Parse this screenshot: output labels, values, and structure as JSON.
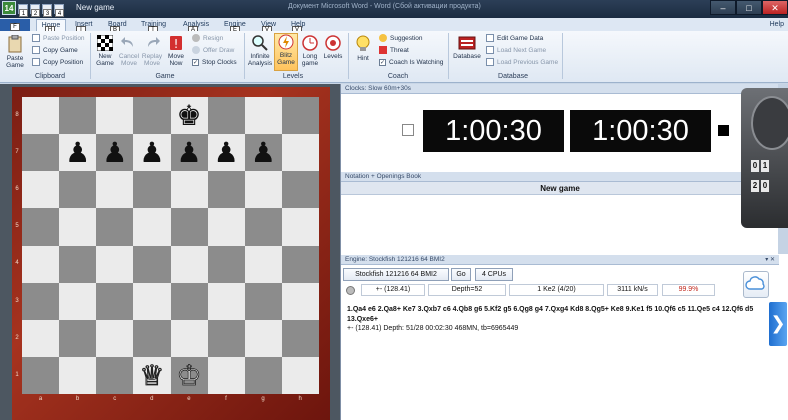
{
  "window": {
    "title": "New game",
    "title_right": "Документ Microsoft Word - Word (Сбой активации продукта)",
    "app_icon_label": "14",
    "quick_access_keys": [
      "1",
      "2",
      "3",
      "4"
    ]
  },
  "menu": {
    "file_label": "F",
    "tabs": [
      {
        "label": "Home",
        "key": "H"
      },
      {
        "label": "Insert",
        "key": "I"
      },
      {
        "label": "Board",
        "key": "B"
      },
      {
        "label": "Training",
        "key": "T"
      },
      {
        "label": "Analysis",
        "key": "A"
      },
      {
        "label": "Engine",
        "key": "E"
      },
      {
        "label": "View",
        "key": "V"
      },
      {
        "label": "Help",
        "key": "V"
      }
    ],
    "help_right": "Help"
  },
  "ribbon": {
    "clipboard": {
      "paste_game": "Paste Game",
      "paste_position": "Paste Position",
      "copy_game": "Copy Game",
      "copy_position": "Copy Position",
      "group_label": "Clipboard"
    },
    "game": {
      "new_game": "New Game",
      "cancel_move": "Cancel Move",
      "replay_move": "Replay Move",
      "move_now": "Move Now",
      "resign": "Resign",
      "offer_draw": "Offer Draw",
      "stop_clocks": "Stop Clocks",
      "group_label": "Game"
    },
    "levels": {
      "infinite_analysis": "Infinite Analysis",
      "blitz_game": "Blitz Game",
      "long_game": "Long game",
      "levels": "Levels",
      "group_label": "Levels"
    },
    "coach": {
      "hint": "Hint",
      "suggestion": "Suggestion",
      "threat": "Threat",
      "coach_is_watching": "Coach Is Watching",
      "group_label": "Coach"
    },
    "database": {
      "database": "Database",
      "edit_game_data": "Edit Game Data",
      "load_next_game": "Load Next Game",
      "load_previous_game": "Load Previous Game",
      "group_label": "Database"
    }
  },
  "board": {
    "ranks": [
      "8",
      "7",
      "6",
      "5",
      "4",
      "3",
      "2",
      "1"
    ],
    "files": [
      "a",
      "b",
      "c",
      "d",
      "e",
      "f",
      "g",
      "h"
    ],
    "pieces": [
      {
        "square": "e8",
        "glyph": "♚",
        "color": "b"
      },
      {
        "square": "b7",
        "glyph": "♟",
        "color": "b"
      },
      {
        "square": "c7",
        "glyph": "♟",
        "color": "b"
      },
      {
        "square": "d7",
        "glyph": "♟",
        "color": "b"
      },
      {
        "square": "e7",
        "glyph": "♟",
        "color": "b"
      },
      {
        "square": "f7",
        "glyph": "♟",
        "color": "b"
      },
      {
        "square": "g7",
        "glyph": "♟",
        "color": "b"
      },
      {
        "square": "d1",
        "glyph": "♕",
        "color": "w"
      },
      {
        "square": "e1",
        "glyph": "♔",
        "color": "w"
      }
    ]
  },
  "clocks": {
    "caption": "Clocks: Slow 60m+30s",
    "white_time": "1:00:30",
    "black_time": "1:00:30"
  },
  "notation": {
    "caption": "Notation + Openings Book",
    "heading": "New game"
  },
  "engine": {
    "caption": "Engine: Stockfish 121216 64 BMI2",
    "name": "Stockfish 121216 64 BMI2",
    "go_label": "Go",
    "cpus_label": "4 CPUs",
    "eval": "+-  (128.41)",
    "depth": "Depth=52",
    "current_move": "1 Ke2 (4/20)",
    "speed": "3111 kN/s",
    "hash": "99.9%",
    "mainline": "1.Qa4 e6 2.Qa8+ Ke7 3.Qxb7 c6 4.Qb8 g6 5.Kf2 g5 6.Qg8 g4 7.Qxg4 Kd8 8.Qg5+ Ke8 9.Ke1 f5 10.Qf6 c5 11.Qe5 c4 12.Qf6 d5 13.Qxe6+",
    "stats": "+-  (128.41)   Depth: 51/28   00:02:30  468MN, tb=6965449"
  },
  "side_clock": {
    "digits": [
      "0",
      "1",
      "2",
      "0"
    ]
  }
}
